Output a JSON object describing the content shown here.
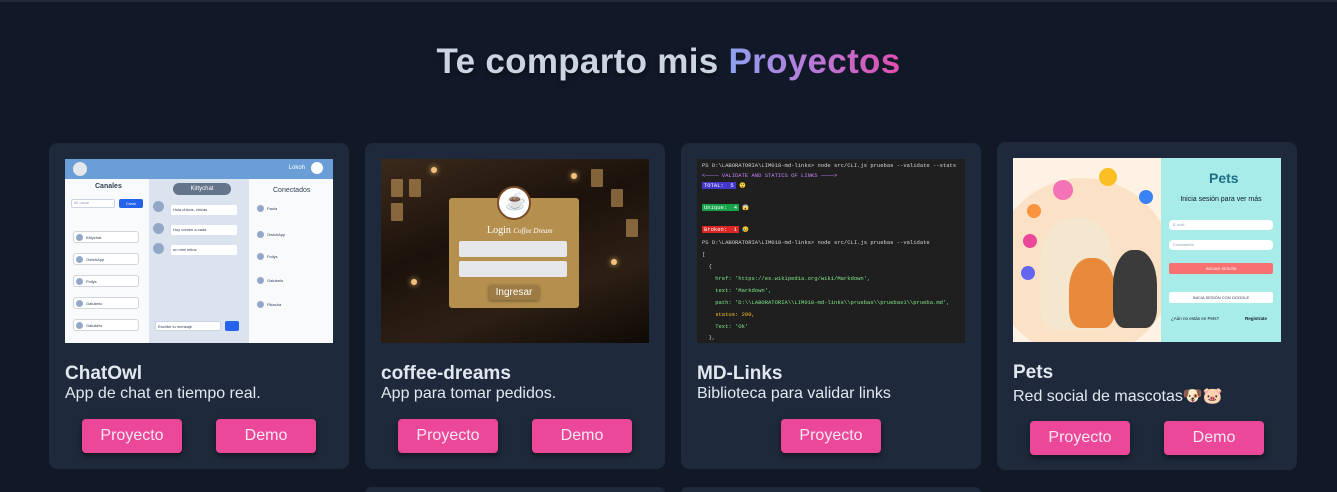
{
  "heading": {
    "prefix": "Te comparto mis",
    "highlight": "Proyectos"
  },
  "projects": [
    {
      "title": "ChatOwl",
      "description": "App de chat en tiempo real.",
      "buttons": [
        "Proyecto",
        "Demo"
      ],
      "screenshot": {
        "user": "Lokoh",
        "channels_title": "Canales",
        "search_placeholder": "Mi canal",
        "create_label": "Crear",
        "channels": [
          "Kittychat",
          "OwlchApp",
          "Pollys",
          "Gatubelo",
          "Gatubelo"
        ],
        "chat_title": "Kittychat",
        "messages": [
          "Hola chicos, chicas",
          "Hoy comen a cada",
          "un mini mitos"
        ],
        "message_placeholder": "Escribe tu mensaje",
        "connected_title": "Conectados",
        "connected": [
          "Paola",
          "OwlchApp",
          "Pollys",
          "Gatubelo",
          "Pikacha"
        ]
      }
    },
    {
      "title": "coffee-dreams",
      "description": "App para tomar pedidos.",
      "buttons": [
        "Proyecto",
        "Demo"
      ],
      "screenshot": {
        "login_label": "Login",
        "brand": "Coffee Dream",
        "submit_label": "Ingresar"
      }
    },
    {
      "title": "MD-Links",
      "description": "Biblioteca para validar links",
      "buttons": [
        "Proyecto"
      ],
      "screenshot": {
        "lines": [
          "PS D:\\LABORATORIA\\LIM018-md-links> node src/CLI.js pruebas --validate --stats",
          "<──── VALIDATE AND STATICS OF LINKS ────>",
          "TOTAL:  5",
          "Unique:  4",
          "Broken:  1",
          "PS D:\\LABORATORIA\\LIM018-md-links> node src/CLI.js pruebas --validate",
          "[",
          "  {",
          "    href: 'https://es.wikipedia.org/wiki/Markdown',",
          "    text: 'Markdown',",
          "    path: 'D:\\\\LABORATORIA\\\\LIM018-md-links\\\\pruebas\\\\pruebas1\\\\prueba.md',",
          "    status: 200,",
          "    Text: 'Ok'",
          "  },"
        ]
      }
    },
    {
      "title": "Pets",
      "description": "Red social de mascotas🐶🐷",
      "buttons": [
        "Proyecto",
        "Demo"
      ],
      "screenshot": {
        "logo": "Pets",
        "login_title": "Inicia sesión para ver más",
        "email_placeholder": "E-mail",
        "password_placeholder": "Contraseña",
        "login_button": "INICIAR SESIÓN",
        "google_button": "INICIA SESIÓN CON GOOGLE",
        "no_account": "¿Aún no estás en Pets?",
        "register": "Regístrate"
      }
    }
  ],
  "colors": {
    "background": "#111827",
    "card": "#1e293b",
    "accent": "#ec4899"
  }
}
